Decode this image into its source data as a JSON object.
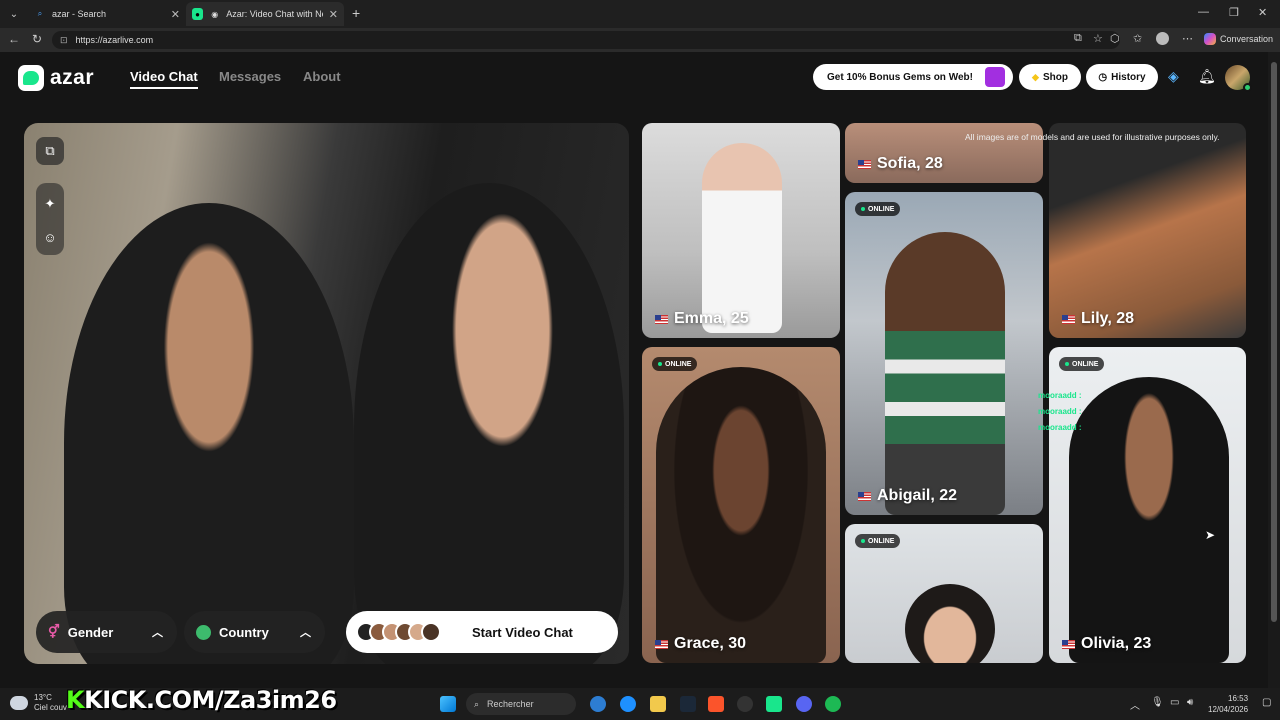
{
  "browser": {
    "tabs": [
      {
        "label": "azar - Search",
        "icon": "search-icon",
        "active": false
      },
      {
        "label": "Azar: Video Chat with New Pe",
        "icon": "azar-favicon",
        "active": true
      }
    ],
    "url": "https://azarlive.com",
    "conversation_label": "Conversation"
  },
  "site": {
    "logo_text": "azar",
    "nav": [
      {
        "label": "Video Chat",
        "active": true
      },
      {
        "label": "Messages",
        "active": false
      },
      {
        "label": "About",
        "active": false
      }
    ],
    "bonus_label": "Get 10% Bonus Gems on Web!",
    "shop_label": "Shop",
    "history_label": "History",
    "accent": "#19e68c"
  },
  "video": {
    "gender_label": "Gender",
    "country_label": "Country",
    "start_label": "Start Video Chat"
  },
  "profiles": {
    "disclaimer": "All images are of models and are used for illustrative purposes only.",
    "online_label": "ONLINE",
    "cards": [
      {
        "name": "Emma, 25"
      },
      {
        "name": "Sofia, 28"
      },
      {
        "name": "Lily, 28"
      },
      {
        "name": "Abigail, 22"
      },
      {
        "name": "Grace, 30"
      },
      {
        "name": "Olivia, 23"
      }
    ],
    "chat_lines": [
      "mooraadd :",
      "mooraadd :",
      "mooraadd :"
    ]
  },
  "taskbar": {
    "temperature": "13°C",
    "weather_text": "Ciel couv",
    "overlay_text": "KICK.COM/Za3im26",
    "search_placeholder": "Rechercher",
    "time": "16:53",
    "date": "12/04/2026"
  }
}
